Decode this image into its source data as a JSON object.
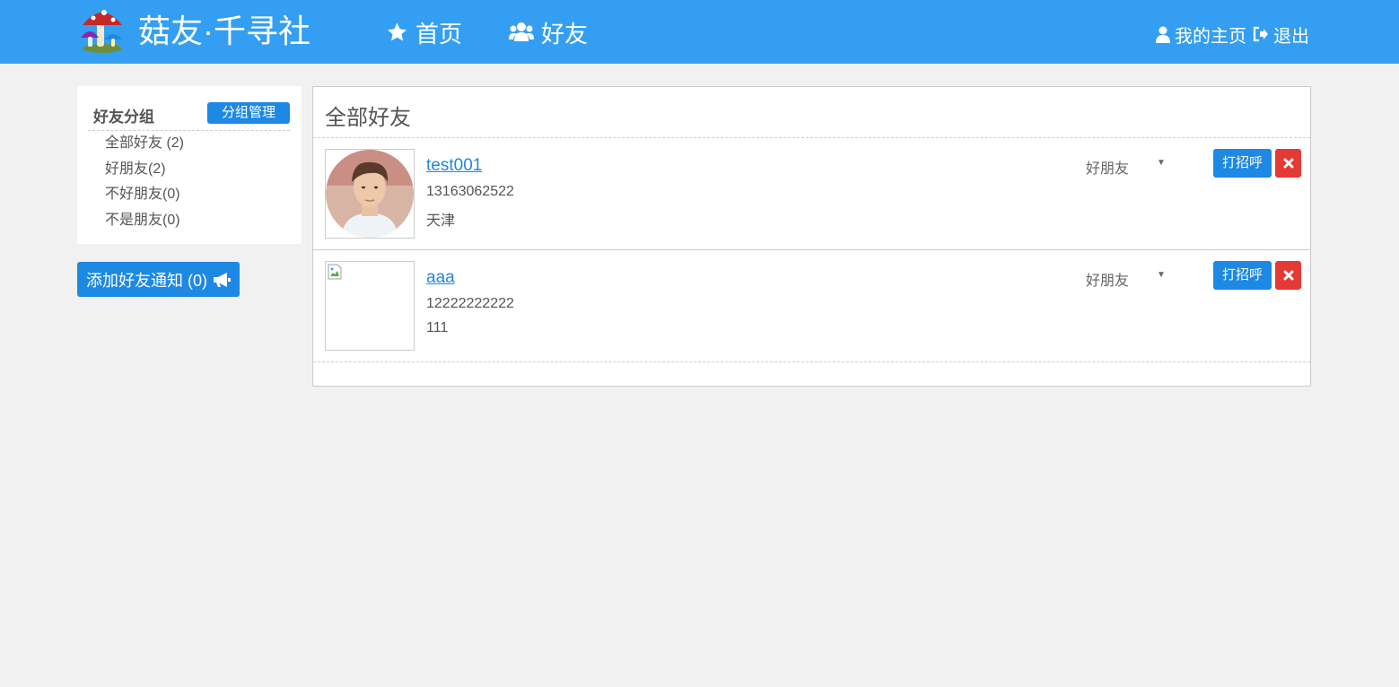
{
  "navbar": {
    "brand": "菇友·千寻社",
    "links": [
      {
        "label": "首页",
        "icon": "star-icon"
      },
      {
        "label": "好友",
        "icon": "users-icon"
      }
    ],
    "right": [
      {
        "label": "我的主页",
        "icon": "user-icon"
      },
      {
        "label": "退出",
        "icon": "sign-out-icon"
      }
    ],
    "bg_color": "#349ff2"
  },
  "sidebar": {
    "title": "好友分组",
    "manage_label": "分组管理",
    "groups": [
      {
        "label": "全部好友 (2)"
      },
      {
        "label": "好朋友(2)"
      },
      {
        "label": "不好朋友(0)"
      },
      {
        "label": "不是朋友(0)"
      }
    ],
    "notify_label": "添加好友通知 (0)",
    "notify_icon": "bullhorn-icon"
  },
  "main": {
    "title": "全部好友",
    "friends": [
      {
        "name": "test001",
        "phone": "13163062522",
        "city": "天津",
        "group": "好朋友",
        "greet_label": "打招呼",
        "avatar": "photo"
      },
      {
        "name": "aaa",
        "phone": "12222222222",
        "city": "111",
        "group": "好朋友",
        "greet_label": "打招呼",
        "avatar": "broken-image"
      }
    ]
  },
  "colors": {
    "accent": "#1e88e5",
    "danger": "#e53935",
    "page_bg": "#f1f1f1"
  }
}
